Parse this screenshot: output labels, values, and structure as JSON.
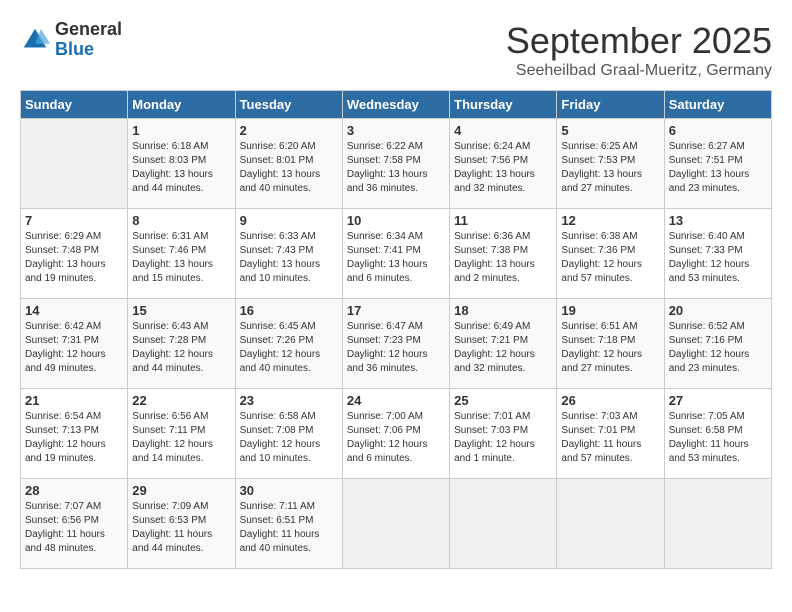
{
  "header": {
    "logo_general": "General",
    "logo_blue": "Blue",
    "month_title": "September 2025",
    "location": "Seeheilbad Graal-Mueritz, Germany"
  },
  "weekdays": [
    "Sunday",
    "Monday",
    "Tuesday",
    "Wednesday",
    "Thursday",
    "Friday",
    "Saturday"
  ],
  "weeks": [
    [
      {
        "day": "",
        "sunrise": "",
        "sunset": "",
        "daylight": ""
      },
      {
        "day": "1",
        "sunrise": "6:18 AM",
        "sunset": "8:03 PM",
        "daylight": "13 hours and 44 minutes."
      },
      {
        "day": "2",
        "sunrise": "6:20 AM",
        "sunset": "8:01 PM",
        "daylight": "13 hours and 40 minutes."
      },
      {
        "day": "3",
        "sunrise": "6:22 AM",
        "sunset": "7:58 PM",
        "daylight": "13 hours and 36 minutes."
      },
      {
        "day": "4",
        "sunrise": "6:24 AM",
        "sunset": "7:56 PM",
        "daylight": "13 hours and 32 minutes."
      },
      {
        "day": "5",
        "sunrise": "6:25 AM",
        "sunset": "7:53 PM",
        "daylight": "13 hours and 27 minutes."
      },
      {
        "day": "6",
        "sunrise": "6:27 AM",
        "sunset": "7:51 PM",
        "daylight": "13 hours and 23 minutes."
      }
    ],
    [
      {
        "day": "7",
        "sunrise": "6:29 AM",
        "sunset": "7:48 PM",
        "daylight": "13 hours and 19 minutes."
      },
      {
        "day": "8",
        "sunrise": "6:31 AM",
        "sunset": "7:46 PM",
        "daylight": "13 hours and 15 minutes."
      },
      {
        "day": "9",
        "sunrise": "6:33 AM",
        "sunset": "7:43 PM",
        "daylight": "13 hours and 10 minutes."
      },
      {
        "day": "10",
        "sunrise": "6:34 AM",
        "sunset": "7:41 PM",
        "daylight": "13 hours and 6 minutes."
      },
      {
        "day": "11",
        "sunrise": "6:36 AM",
        "sunset": "7:38 PM",
        "daylight": "13 hours and 2 minutes."
      },
      {
        "day": "12",
        "sunrise": "6:38 AM",
        "sunset": "7:36 PM",
        "daylight": "12 hours and 57 minutes."
      },
      {
        "day": "13",
        "sunrise": "6:40 AM",
        "sunset": "7:33 PM",
        "daylight": "12 hours and 53 minutes."
      }
    ],
    [
      {
        "day": "14",
        "sunrise": "6:42 AM",
        "sunset": "7:31 PM",
        "daylight": "12 hours and 49 minutes."
      },
      {
        "day": "15",
        "sunrise": "6:43 AM",
        "sunset": "7:28 PM",
        "daylight": "12 hours and 44 minutes."
      },
      {
        "day": "16",
        "sunrise": "6:45 AM",
        "sunset": "7:26 PM",
        "daylight": "12 hours and 40 minutes."
      },
      {
        "day": "17",
        "sunrise": "6:47 AM",
        "sunset": "7:23 PM",
        "daylight": "12 hours and 36 minutes."
      },
      {
        "day": "18",
        "sunrise": "6:49 AM",
        "sunset": "7:21 PM",
        "daylight": "12 hours and 32 minutes."
      },
      {
        "day": "19",
        "sunrise": "6:51 AM",
        "sunset": "7:18 PM",
        "daylight": "12 hours and 27 minutes."
      },
      {
        "day": "20",
        "sunrise": "6:52 AM",
        "sunset": "7:16 PM",
        "daylight": "12 hours and 23 minutes."
      }
    ],
    [
      {
        "day": "21",
        "sunrise": "6:54 AM",
        "sunset": "7:13 PM",
        "daylight": "12 hours and 19 minutes."
      },
      {
        "day": "22",
        "sunrise": "6:56 AM",
        "sunset": "7:11 PM",
        "daylight": "12 hours and 14 minutes."
      },
      {
        "day": "23",
        "sunrise": "6:58 AM",
        "sunset": "7:08 PM",
        "daylight": "12 hours and 10 minutes."
      },
      {
        "day": "24",
        "sunrise": "7:00 AM",
        "sunset": "7:06 PM",
        "daylight": "12 hours and 6 minutes."
      },
      {
        "day": "25",
        "sunrise": "7:01 AM",
        "sunset": "7:03 PM",
        "daylight": "12 hours and 1 minute."
      },
      {
        "day": "26",
        "sunrise": "7:03 AM",
        "sunset": "7:01 PM",
        "daylight": "11 hours and 57 minutes."
      },
      {
        "day": "27",
        "sunrise": "7:05 AM",
        "sunset": "6:58 PM",
        "daylight": "11 hours and 53 minutes."
      }
    ],
    [
      {
        "day": "28",
        "sunrise": "7:07 AM",
        "sunset": "6:56 PM",
        "daylight": "11 hours and 48 minutes."
      },
      {
        "day": "29",
        "sunrise": "7:09 AM",
        "sunset": "6:53 PM",
        "daylight": "11 hours and 44 minutes."
      },
      {
        "day": "30",
        "sunrise": "7:11 AM",
        "sunset": "6:51 PM",
        "daylight": "11 hours and 40 minutes."
      },
      {
        "day": "",
        "sunrise": "",
        "sunset": "",
        "daylight": ""
      },
      {
        "day": "",
        "sunrise": "",
        "sunset": "",
        "daylight": ""
      },
      {
        "day": "",
        "sunrise": "",
        "sunset": "",
        "daylight": ""
      },
      {
        "day": "",
        "sunrise": "",
        "sunset": "",
        "daylight": ""
      }
    ]
  ]
}
